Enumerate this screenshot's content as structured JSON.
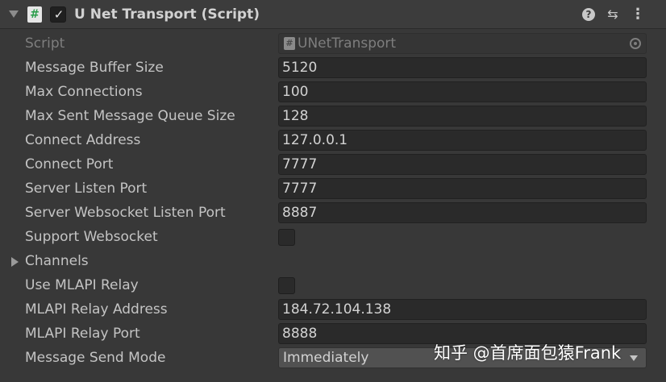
{
  "header": {
    "title": "U Net Transport (Script)",
    "script_glyph": "#",
    "enabled_glyph": "✓",
    "help_glyph": "?",
    "preset_glyph": "⇆",
    "menu_glyph": "⋮",
    "enabled": true
  },
  "script_row": {
    "label": "Script",
    "value": "UNetTransport",
    "icon_glyph": "#"
  },
  "fields": [
    {
      "label": "Message Buffer Size",
      "value": "5120"
    },
    {
      "label": "Max Connections",
      "value": "100"
    },
    {
      "label": "Max Sent Message Queue Size",
      "value": "128"
    },
    {
      "label": "Connect Address",
      "value": "127.0.0.1"
    },
    {
      "label": "Connect Port",
      "value": "7777"
    },
    {
      "label": "Server Listen Port",
      "value": "7777"
    },
    {
      "label": "Server Websocket Listen Port",
      "value": "8887"
    }
  ],
  "support_websocket": {
    "label": "Support Websocket",
    "checked": false
  },
  "channels": {
    "label": "Channels",
    "expanded": false
  },
  "use_relay": {
    "label": "Use MLAPI Relay",
    "checked": false
  },
  "relay_fields": [
    {
      "label": "MLAPI Relay Address",
      "value": "184.72.104.138"
    },
    {
      "label": "MLAPI Relay Port",
      "value": "8888"
    }
  ],
  "send_mode": {
    "label": "Message Send Mode",
    "value": "Immediately"
  },
  "watermark": "知乎 @首席面包猿Frank",
  "colors": {
    "background": "#383838",
    "header": "#3c3c3c",
    "field": "#2a2a2a",
    "text": "#c4c4c4",
    "script_icon_accent": "#2a9d4a"
  }
}
